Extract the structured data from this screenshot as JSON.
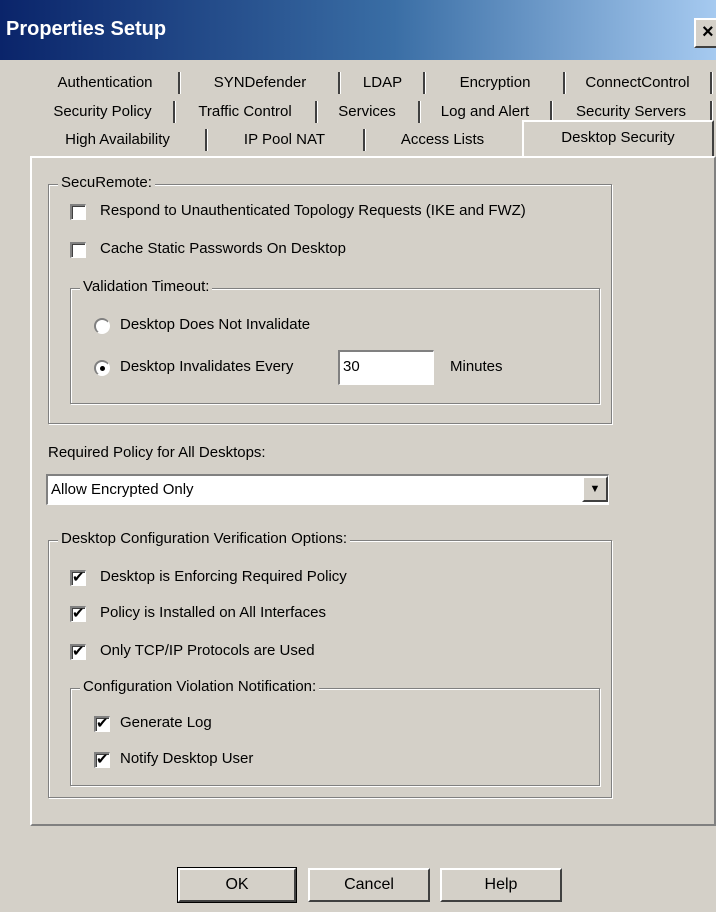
{
  "window": {
    "title": "Properties Setup",
    "close_glyph": "×"
  },
  "tabs": {
    "row1": [
      "Authentication",
      "SYNDefender",
      "LDAP",
      "Encryption",
      "ConnectControl"
    ],
    "row2": [
      "Security Policy",
      "Traffic Control",
      "Services",
      "Log and Alert",
      "Security Servers"
    ],
    "row3": [
      "High Availability",
      "IP Pool NAT",
      "Access Lists",
      "Desktop Security"
    ],
    "active": "Desktop Security"
  },
  "securemote": {
    "legend": "SecuRemote:",
    "respond_unauth": {
      "label": "Respond to Unauthenticated Topology Requests (IKE and FWZ)",
      "checked": false
    },
    "cache_passwords": {
      "label": "Cache Static Passwords On Desktop",
      "checked": false
    },
    "validation": {
      "legend": "Validation Timeout:",
      "no_invalidate_label": "Desktop Does Not Invalidate",
      "invalidates_every_label": "Desktop Invalidates Every",
      "minutes_value": "30",
      "minutes_label": "Minutes",
      "selected": "invalidates_every"
    }
  },
  "required_policy": {
    "label": "Required Policy for All Desktops:",
    "value": "Allow Encrypted Only"
  },
  "verification": {
    "legend": "Desktop Configuration Verification Options:",
    "enforcing_policy": {
      "label": "Desktop is Enforcing Required Policy",
      "checked": true
    },
    "installed_all_interfaces": {
      "label": "Policy is Installed on All Interfaces",
      "checked": true
    },
    "only_tcpip": {
      "label": "Only TCP/IP Protocols are Used",
      "checked": true
    },
    "notification": {
      "legend": "Configuration Violation Notification:",
      "generate_log": {
        "label": "Generate Log",
        "checked": true
      },
      "notify_user": {
        "label": "Notify Desktop User",
        "checked": true
      }
    }
  },
  "buttons": {
    "ok": "OK",
    "cancel": "Cancel",
    "help": "Help"
  },
  "icons": {
    "checkmark": "check-icon",
    "dropdown_arrow": "chevron-down-icon",
    "close": "close-icon"
  }
}
